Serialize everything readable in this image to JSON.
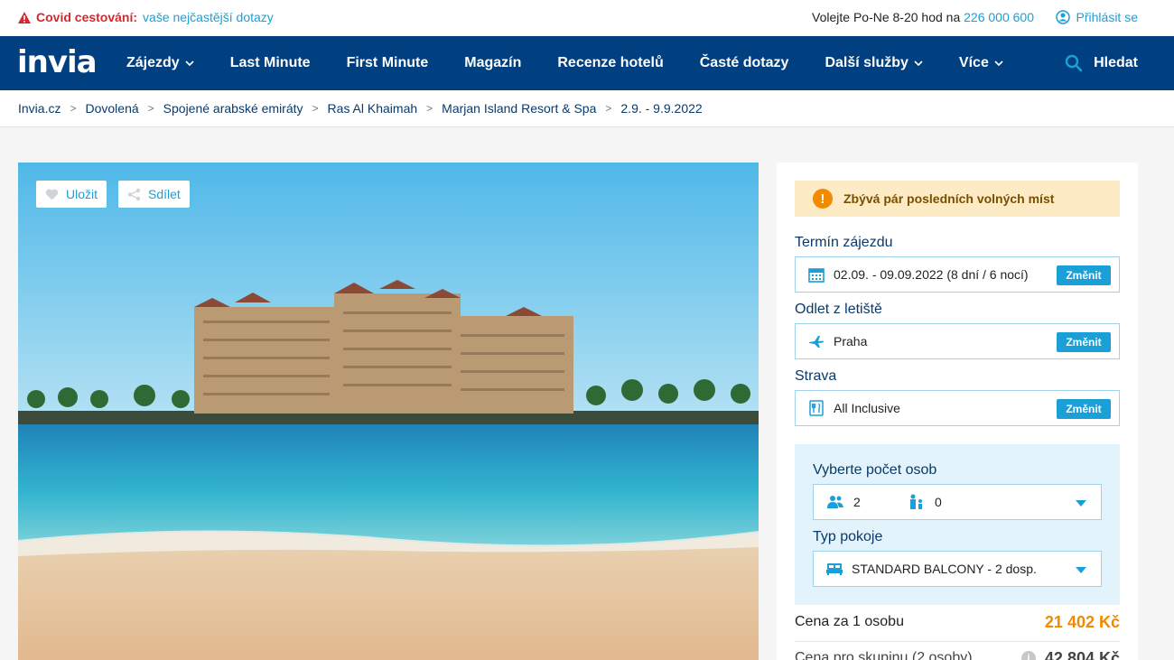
{
  "topbar": {
    "covid_label": "Covid cestování:",
    "covid_link": "vaše nejčastější dotazy",
    "contact_text": "Volejte Po-Ne 8-20 hod na",
    "phone": "226 000 600",
    "login": "Přihlásit se"
  },
  "nav": {
    "logo": "invia",
    "items": [
      {
        "label": "Zájezdy",
        "dropdown": true
      },
      {
        "label": "Last Minute",
        "dropdown": false
      },
      {
        "label": "First Minute",
        "dropdown": false
      },
      {
        "label": "Magazín",
        "dropdown": false
      },
      {
        "label": "Recenze hotelů",
        "dropdown": false
      },
      {
        "label": "Časté dotazy",
        "dropdown": false
      },
      {
        "label": "Další služby",
        "dropdown": true
      },
      {
        "label": "Více",
        "dropdown": true
      }
    ],
    "search": "Hledat"
  },
  "breadcrumb": [
    "Invia.cz",
    "Dovolená",
    "Spojené arabské emiráty",
    "Ras Al Khaimah",
    "Marjan Island Resort & Spa",
    "2.9. - 9.9.2022"
  ],
  "photo": {
    "save": "Uložit",
    "share": "Sdílet"
  },
  "booking": {
    "alert": "Zbývá pár posledních volných míst",
    "term_label": "Termín zájezdu",
    "term_value": "02.09. - 09.09.2022 (8 dní / 6 nocí)",
    "airport_label": "Odlet z letiště",
    "airport_value": "Praha",
    "board_label": "Strava",
    "board_value": "All Inclusive",
    "change": "Změnit",
    "persons_label": "Vyberte počet osob",
    "adults": "2",
    "children": "0",
    "room_label": "Typ pokoje",
    "room_value": "STANDARD BALCONY - 2 dosp.",
    "price_person_label": "Cena za 1 osobu",
    "price_person": "21 402 Kč",
    "price_group_label": "Cena pro skupinu (2 osoby)",
    "price_group": "42 804 Kč"
  },
  "colors": {
    "nav_bg": "#003f80",
    "accent": "#1a9fd6",
    "price": "#f28a00",
    "alert_bg": "#fdebc5",
    "covid_red": "#d6262f"
  }
}
